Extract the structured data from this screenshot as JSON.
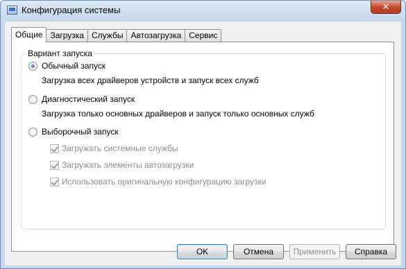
{
  "window": {
    "title": "Конфигурация системы",
    "close_symbol": "✕"
  },
  "tabs": [
    {
      "label": "Общие",
      "active": true
    },
    {
      "label": "Загрузка",
      "active": false
    },
    {
      "label": "Службы",
      "active": false
    },
    {
      "label": "Автозагрузка",
      "active": false
    },
    {
      "label": "Сервис",
      "active": false
    }
  ],
  "startup_group": {
    "legend": "Вариант запуска",
    "options": [
      {
        "label": "Обычный запуск",
        "description": "Загрузка всех драйверов устройств и запуск всех служб",
        "selected": true
      },
      {
        "label": "Диагностический запуск",
        "description": "Загрузка только основных драйверов и запуск только основных служб",
        "selected": false
      },
      {
        "label": "Выборочный запуск",
        "description": "",
        "selected": false
      }
    ],
    "selective_checkboxes": [
      {
        "label": "Загружать системные службы",
        "checked": true,
        "enabled": false
      },
      {
        "label": "Загружать элементы автозагрузки",
        "checked": true,
        "enabled": false
      },
      {
        "label": "Использовать оригинальную конфигурацию загрузки",
        "checked": true,
        "enabled": false
      }
    ]
  },
  "buttons": {
    "ok": "OK",
    "cancel": "Отмена",
    "apply": "Применить",
    "help": "Справка"
  }
}
